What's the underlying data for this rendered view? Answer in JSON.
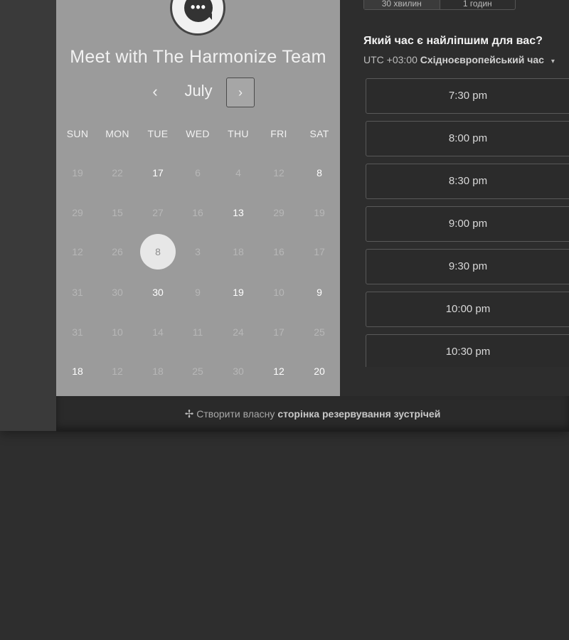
{
  "meeting": {
    "title": "Meet with The Harmonize Team",
    "avatar_icon": "chat-bubble-icon",
    "avatar_glyph": "•••"
  },
  "calendar": {
    "month": "July",
    "prev_icon": "chevron-left-icon",
    "next_icon": "chevron-right-icon",
    "prev_glyph": "‹",
    "next_glyph": "›",
    "weekdays": [
      "SUN",
      "MON",
      "TUE",
      "WED",
      "THU",
      "FRI",
      "SAT"
    ],
    "weeks": [
      [
        {
          "d": "19",
          "a": false
        },
        {
          "d": "22",
          "a": false
        },
        {
          "d": "17",
          "a": true
        },
        {
          "d": "6",
          "a": false
        },
        {
          "d": "4",
          "a": false
        },
        {
          "d": "12",
          "a": false
        },
        {
          "d": "8",
          "a": true
        }
      ],
      [
        {
          "d": "29",
          "a": false
        },
        {
          "d": "15",
          "a": false
        },
        {
          "d": "27",
          "a": false
        },
        {
          "d": "16",
          "a": false
        },
        {
          "d": "13",
          "a": true
        },
        {
          "d": "29",
          "a": false
        },
        {
          "d": "19",
          "a": false
        }
      ],
      [
        {
          "d": "12",
          "a": false
        },
        {
          "d": "26",
          "a": false
        },
        {
          "d": "8",
          "a": true,
          "selected": true
        },
        {
          "d": "3",
          "a": false
        },
        {
          "d": "18",
          "a": false
        },
        {
          "d": "16",
          "a": false
        },
        {
          "d": "17",
          "a": false
        }
      ],
      [
        {
          "d": "31",
          "a": false
        },
        {
          "d": "30",
          "a": false
        },
        {
          "d": "30",
          "a": true
        },
        {
          "d": "9",
          "a": false
        },
        {
          "d": "19",
          "a": true
        },
        {
          "d": "10",
          "a": false
        },
        {
          "d": "9",
          "a": true
        }
      ],
      [
        {
          "d": "31",
          "a": false
        },
        {
          "d": "10",
          "a": false
        },
        {
          "d": "14",
          "a": false
        },
        {
          "d": "11",
          "a": false
        },
        {
          "d": "24",
          "a": false
        },
        {
          "d": "17",
          "a": false
        },
        {
          "d": "25",
          "a": false
        }
      ],
      [
        {
          "d": "18",
          "a": true
        },
        {
          "d": "12",
          "a": false
        },
        {
          "d": "18",
          "a": false
        },
        {
          "d": "25",
          "a": false
        },
        {
          "d": "30",
          "a": false
        },
        {
          "d": "12",
          "a": true
        },
        {
          "d": "20",
          "a": true
        }
      ]
    ]
  },
  "duration": {
    "options": [
      "30 хвилин",
      "1 годин"
    ]
  },
  "times": {
    "question": "Який час є найліпшим для вас?",
    "tz_offset": "UTC +03:00",
    "tz_name": "Східноєвропейський час",
    "tz_caret": "▾",
    "slots": [
      "7:30 pm",
      "8:00 pm",
      "8:30 pm",
      "9:00 pm",
      "9:30 pm",
      "10:00 pm",
      "10:30 pm"
    ]
  },
  "footer": {
    "icon": "hubspot-sprocket-icon",
    "icon_glyph": "✢",
    "text": "Створити власну",
    "link": "сторінка резервування зустрічей"
  },
  "colors": {
    "calendar_panel": "#9b9b9b",
    "times_panel": "#2d2d2d",
    "selected_day": "#e7e7e7"
  }
}
